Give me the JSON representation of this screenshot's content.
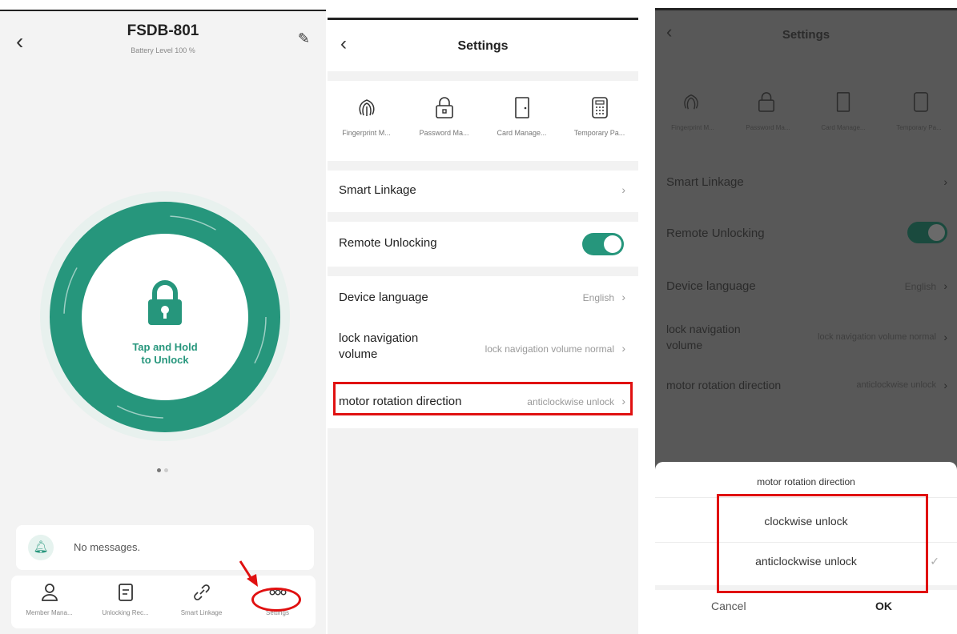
{
  "panel1": {
    "back_icon": "‹",
    "title": "FSDB-801",
    "subtitle": "Battery Level 100 %",
    "edit_icon": "✎",
    "lock_label_line1": "Tap and Hold",
    "lock_label_line2": "to Unlock",
    "messages_text": "No messages.",
    "tabs": [
      {
        "label": "Member Mana...",
        "icon": "person-icon"
      },
      {
        "label": "Unlocking Rec...",
        "icon": "document-icon"
      },
      {
        "label": "Smart Linkage",
        "icon": "link-icon"
      },
      {
        "label": "Settings",
        "icon": "more-icon"
      }
    ],
    "accent_color": "#26967c",
    "highlight_color": "#e01010"
  },
  "panel2": {
    "title": "Settings",
    "quick_items": [
      {
        "label": "Fingerprint M...",
        "icon": "fingerprint-icon"
      },
      {
        "label": "Password Ma...",
        "icon": "lock-icon"
      },
      {
        "label": "Card Manage...",
        "icon": "door-icon"
      },
      {
        "label": "Temporary Pa...",
        "icon": "keypad-icon"
      }
    ],
    "smart_linkage": "Smart Linkage",
    "remote_unlocking": "Remote Unlocking",
    "remote_unlocking_on": true,
    "device_language_label": "Device language",
    "device_language_value": "English",
    "nav_volume_label_1": "lock navigation",
    "nav_volume_label_2": "volume",
    "nav_volume_value": "lock navigation volume normal",
    "motor_label": "motor rotation direction",
    "motor_value": "anticlockwise unlock"
  },
  "panel3": {
    "title": "Settings",
    "quick_items": [
      "Fingerprint M...",
      "Password Ma...",
      "Card Manage...",
      "Temporary Pa..."
    ],
    "smart_linkage": "Smart Linkage",
    "remote_unlocking": "Remote Unlocking",
    "device_language_label": "Device language",
    "device_language_value": "English",
    "nav_volume_label_1": "lock navigation",
    "nav_volume_label_2": "volume",
    "nav_volume_value": "lock navigation volume normal",
    "motor_label": "motor rotation direction",
    "motor_value": "anticlockwise unlock",
    "sheet": {
      "title": "motor rotation direction",
      "options": [
        "clockwise unlock",
        "anticlockwise unlock"
      ],
      "selected": "anticlockwise unlock",
      "cancel": "Cancel",
      "ok": "OK"
    }
  }
}
